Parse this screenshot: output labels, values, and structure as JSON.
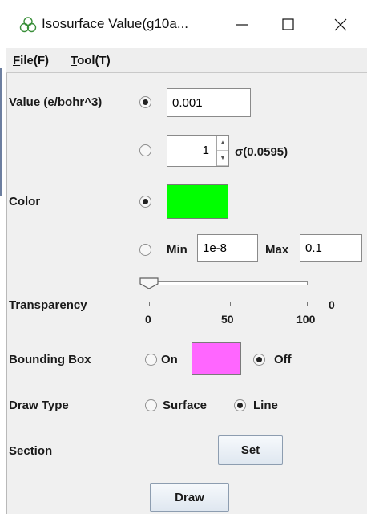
{
  "window": {
    "title": "Isosurface Value(g10a...",
    "controls": [
      "minimize",
      "maximize",
      "close"
    ]
  },
  "menu": {
    "file": {
      "key": "F",
      "rest": "ile(F)"
    },
    "tool": {
      "key": "T",
      "rest": "ool(T)"
    }
  },
  "value": {
    "label": "Value (e/bohr^3)",
    "input": "0.001",
    "selected": true
  },
  "sigma": {
    "spinner_value": "1",
    "label": "σ(0.0595)",
    "selected": false
  },
  "color": {
    "label": "Color",
    "selected": true,
    "swatch": "#00ff00"
  },
  "range": {
    "selected": false,
    "min_label": "Min",
    "min_value": "1e-8",
    "max_label": "Max",
    "max_value": "0.1"
  },
  "transparency": {
    "label": "Transparency",
    "value": 0,
    "value_text": "0",
    "ticks": [
      "0",
      "50",
      "100"
    ]
  },
  "bounding_box": {
    "label": "Bounding Box",
    "on_label": "On",
    "off_label": "Off",
    "selected": "off",
    "swatch": "#ff66ff"
  },
  "draw_type": {
    "label": "Draw Type",
    "surface_label": "Surface",
    "line_label": "Line",
    "selected": "line"
  },
  "section": {
    "label": "Section",
    "button": "Set"
  },
  "footer": {
    "button": "Draw"
  },
  "colors": {
    "accent_edge": "#6d7fa0",
    "button_border": "#8d9db0"
  }
}
